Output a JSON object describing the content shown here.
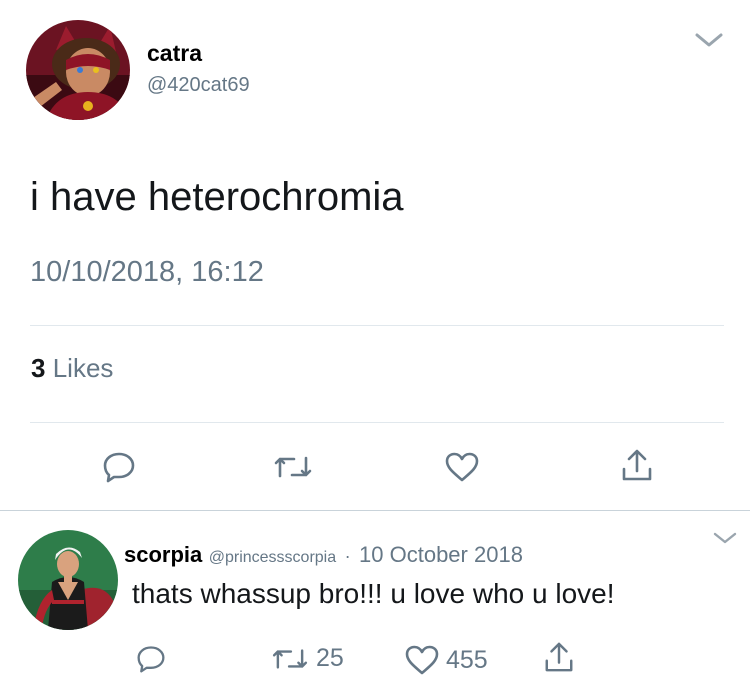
{
  "main_tweet": {
    "display_name": "catra",
    "handle": "@420cat69",
    "text": "i have heterochromia",
    "timestamp": "10/10/2018, 16:12",
    "likes_count": "3",
    "likes_label": "Likes",
    "avatar_icon": "catra-avatar",
    "menu_icon": "chevron-down-icon",
    "actions": [
      {
        "icon": "reply-icon"
      },
      {
        "icon": "retweet-icon"
      },
      {
        "icon": "like-icon"
      },
      {
        "icon": "share-icon"
      }
    ]
  },
  "reply": {
    "display_name": "scorpia",
    "handle": "@princessscorpia",
    "separator": "·",
    "date": "10 October 2018",
    "text": "thats whassup bro!!! u love who u love!",
    "avatar_icon": "scorpia-avatar",
    "menu_icon": "chevron-down-icon",
    "retweets": "25",
    "likes": "455"
  },
  "colors": {
    "text": "#14171a",
    "muted": "#657786",
    "divider": "#e1e8ed",
    "catra_bg": "#6b1322",
    "scorpia_bg": "#2e7d4a"
  }
}
